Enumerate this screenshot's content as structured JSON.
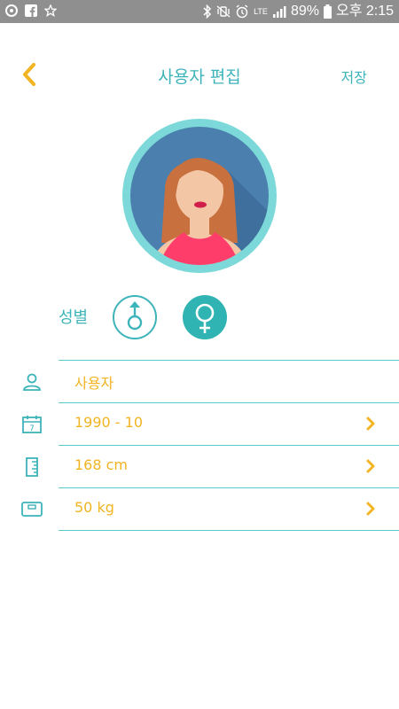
{
  "status_bar": {
    "battery_percent": "89%",
    "time": "오후 2:15",
    "network": "LTE",
    "icons": [
      "app-icon",
      "facebook-icon",
      "star-icon",
      "bluetooth-icon",
      "vibrate-icon",
      "alarm-icon",
      "signal-icon",
      "battery-icon"
    ]
  },
  "header": {
    "title": "사용자 편집",
    "save_label": "저장",
    "back_icon": "chevron-left-icon"
  },
  "avatar": {
    "icon": "female-avatar-icon"
  },
  "gender": {
    "label": "성별",
    "options": [
      {
        "name": "male",
        "icon": "male-symbol-icon",
        "selected": false
      },
      {
        "name": "female",
        "icon": "female-symbol-icon",
        "selected": true
      }
    ]
  },
  "fields": [
    {
      "icon": "user-icon",
      "value": "사용자",
      "has_chevron": false
    },
    {
      "icon": "calendar-icon",
      "value": "1990 - 10",
      "has_chevron": true
    },
    {
      "icon": "ruler-icon",
      "value": "168 cm",
      "has_chevron": true
    },
    {
      "icon": "scale-icon",
      "value": "50 kg",
      "has_chevron": true
    }
  ],
  "colors": {
    "accent_teal": "#3cb4b9",
    "value_yellow": "#f1b422",
    "status_bar": "#8f8f8f"
  }
}
